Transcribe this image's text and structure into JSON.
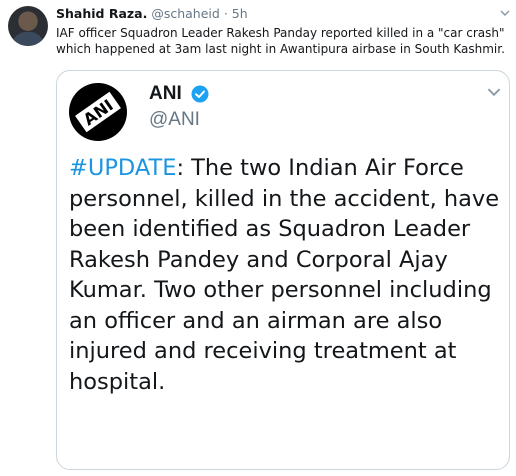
{
  "tweet": {
    "author_name": "Shahid Raza.",
    "author_handle": "@schaheid",
    "separator": "·",
    "time": "5h",
    "text": "IAF officer Squadron Leader Rakesh Panday reported killed in a \"car crash\" which happened at 3am last night in Awantipura airbase in South Kashmir.",
    "avatar_icon": "profile-photo"
  },
  "quoted_tweet": {
    "author_name": "ANI",
    "author_handle": "@ANI",
    "logo_text": "ANI",
    "verified_icon": "verified-badge-icon",
    "hashtag": "#UPDATE",
    "body": ": The two Indian Air Force personnel, killed in the accident, have been identified as Squadron Leader Rakesh Pandey and Corporal Ajay Kumar. Two other personnel including an officer and an airman are also injured and receiving treatment at hospital."
  },
  "colors": {
    "text": "#14171a",
    "muted": "#657786",
    "link": "#1b95e0",
    "border": "#ccd6dd",
    "verified": "#1da1f2"
  }
}
